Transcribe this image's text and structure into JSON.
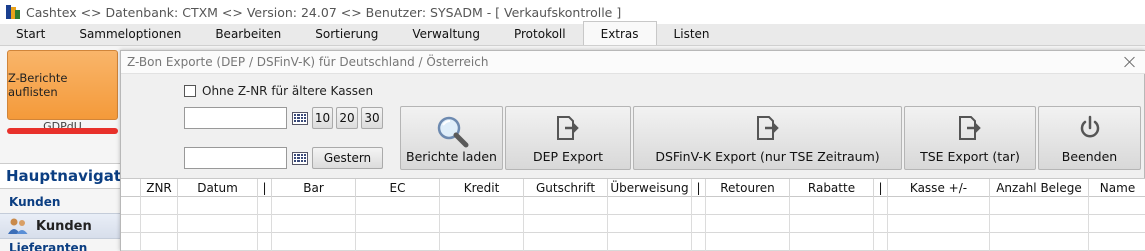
{
  "window": {
    "title": "Cashtex <> Datenbank: CTXM  <>  Version: 24.07  <>  Benutzer: SYSADM - [ Verkaufskontrolle ]"
  },
  "menu": {
    "tabs": [
      {
        "label": "Start"
      },
      {
        "label": "Sammeloptionen"
      },
      {
        "label": "Bearbeiten"
      },
      {
        "label": "Sortierung"
      },
      {
        "label": "Verwaltung"
      },
      {
        "label": "Protokoll"
      },
      {
        "label": "Extras"
      },
      {
        "label": "Listen"
      }
    ],
    "active_tab": "Extras"
  },
  "ribbon": {
    "z_berichte_label": "Z-Berichte auflisten",
    "group_label": "GDPdU"
  },
  "leftnav": {
    "header": "Hauptnavigation",
    "group_kunden": "Kunden",
    "item_kunden": "Kunden",
    "group_lieferanten": "Lieferanten"
  },
  "dialog": {
    "title": "Z-Bon Exporte (DEP / DSFinV-K) für Deutschland / Österreich",
    "checkbox_label": "Ohne Z-NR für ältere Kassen",
    "checkbox_checked": false,
    "date_from_value": "",
    "date_to_value": "",
    "quick_buttons": [
      "10",
      "20",
      "30"
    ],
    "gestern_label": "Gestern",
    "actions": {
      "berichte_laden": "Berichte laden",
      "dep_export": "DEP Export",
      "dsfinvk_export": "DSFinV-K Export (nur TSE Zeitraum)",
      "tse_export": "TSE Export (tar)",
      "beenden": "Beenden"
    },
    "grid": {
      "columns": [
        "",
        "ZNR",
        "Datum",
        "|",
        "Bar",
        "EC",
        "Kredit",
        "Gutschrift",
        "Überweisung",
        "|",
        "Retouren",
        "Rabatte",
        "|",
        "Kasse +/-",
        "Anzahl Belege",
        "Name"
      ],
      "rows": 3
    }
  },
  "colors": {
    "accent_orange": "#f49a3a",
    "nav_blue": "#0b3e82",
    "red_bar": "#e8312b"
  }
}
